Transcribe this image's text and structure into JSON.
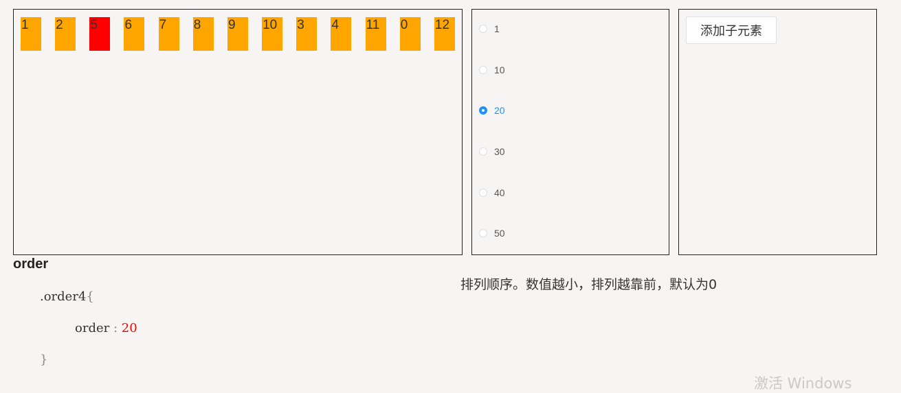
{
  "flex_items": [
    {
      "label": "1",
      "active": false
    },
    {
      "label": "2",
      "active": false
    },
    {
      "label": "5",
      "active": true
    },
    {
      "label": "6",
      "active": false
    },
    {
      "label": "7",
      "active": false
    },
    {
      "label": "8",
      "active": false
    },
    {
      "label": "9",
      "active": false
    },
    {
      "label": "10",
      "active": false
    },
    {
      "label": "3",
      "active": false
    },
    {
      "label": "4",
      "active": false
    },
    {
      "label": "11",
      "active": false
    },
    {
      "label": "0",
      "active": false
    },
    {
      "label": "12",
      "active": false
    }
  ],
  "colors": {
    "item": "#ffa500",
    "active_item": "#ff0000",
    "radio_selected": "#1e90ff"
  },
  "radio": {
    "options": [
      "1",
      "10",
      "20",
      "30",
      "40",
      "50"
    ],
    "selected": "20"
  },
  "actions": {
    "add_child_label": "添加子元素"
  },
  "section": {
    "title": "order",
    "description": "排列顺序。数值越小，排列越靠前，默认为0"
  },
  "code": {
    "selector": ".order4",
    "open_brace": "{",
    "property": "order",
    "colon": " : ",
    "value": "20",
    "close_brace": "}"
  },
  "watermark": "激活 Windows"
}
